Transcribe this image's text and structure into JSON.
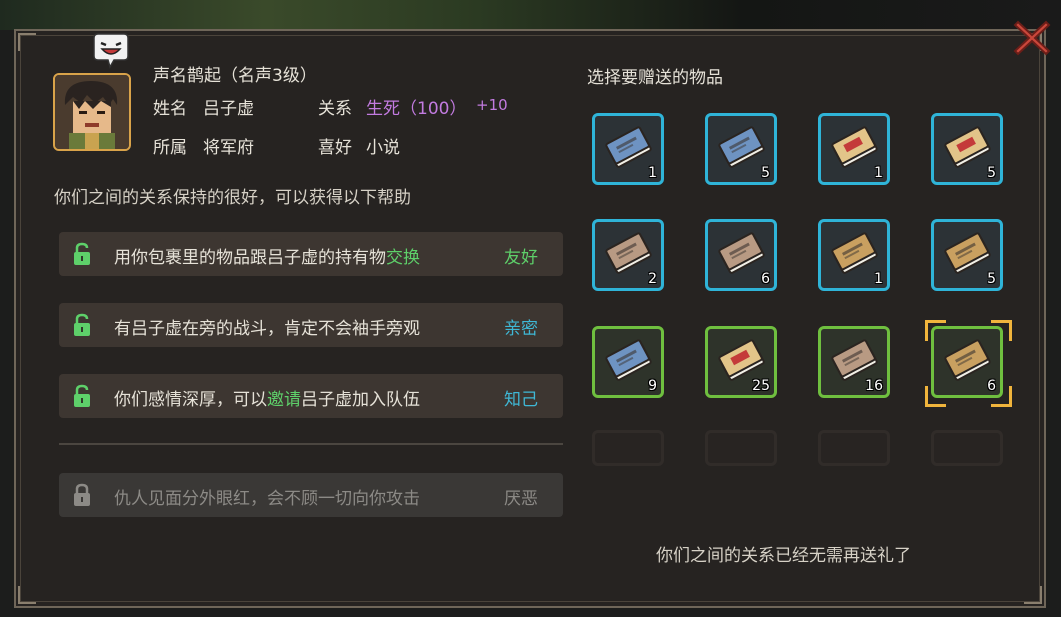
{
  "character": {
    "fame": "声名鹊起（名声3级）",
    "name_label": "姓名",
    "name": "吕子虚",
    "relation_label": "关系",
    "relation": "生死（100）",
    "relation_bonus": "+10",
    "faction_label": "所属",
    "faction": "将军府",
    "hobby_label": "喜好",
    "hobby": "小说"
  },
  "description": "你们之间的关系保持的很好，可以获得以下帮助",
  "benefits": [
    {
      "pre": "用你包裹里的物品跟吕子虚的持有物",
      "highlight": "交换",
      "post": "",
      "level": "友好",
      "level_color": "#5ed06a",
      "unlocked": true
    },
    {
      "pre": "有吕子虚在旁的战斗，肯定不会袖手旁观",
      "highlight": "",
      "post": "",
      "level": "亲密",
      "level_color": "#3fb8d6",
      "unlocked": true
    },
    {
      "pre": "你们感情深厚，可以",
      "highlight": "邀请",
      "post": "吕子虚加入队伍",
      "level": "知己",
      "level_color": "#3fb8d6",
      "unlocked": true
    },
    {
      "pre": "仇人见面分外眼红，会不顾一切向你攻击",
      "highlight": "",
      "post": "",
      "level": "厌恶",
      "level_color": "#8c8a86",
      "unlocked": false
    }
  ],
  "gift_title": "选择要赠送的物品",
  "items": [
    {
      "icon": "book-blue-icon",
      "qty": "1",
      "rarity": "blue",
      "cover": "#6e93c2"
    },
    {
      "icon": "book-blue-icon",
      "qty": "5",
      "rarity": "blue",
      "cover": "#6e93c2"
    },
    {
      "icon": "book-tan-red-icon",
      "qty": "1",
      "rarity": "blue",
      "cover": "#e2c489"
    },
    {
      "icon": "book-tan-red-icon",
      "qty": "5",
      "rarity": "blue",
      "cover": "#e2c489"
    },
    {
      "icon": "book-brown-icon",
      "qty": "2",
      "rarity": "blue",
      "cover": "#b89a83"
    },
    {
      "icon": "book-brown-icon",
      "qty": "6",
      "rarity": "blue",
      "cover": "#b89a83"
    },
    {
      "icon": "book-gold-icon",
      "qty": "1",
      "rarity": "blue",
      "cover": "#c9a060"
    },
    {
      "icon": "book-gold-icon",
      "qty": "5",
      "rarity": "blue",
      "cover": "#c9a060"
    },
    {
      "icon": "book-blue-icon",
      "qty": "9",
      "rarity": "green",
      "cover": "#6e93c2"
    },
    {
      "icon": "book-tan-red-icon",
      "qty": "25",
      "rarity": "green",
      "cover": "#e2c489"
    },
    {
      "icon": "book-brown-icon",
      "qty": "16",
      "rarity": "green",
      "cover": "#b89a83"
    },
    {
      "icon": "book-gold-icon",
      "qty": "6",
      "rarity": "green",
      "cover": "#c9a060",
      "selected": true
    }
  ],
  "footer_note": "你们之间的关系已经无需再送礼了",
  "colors": {
    "accent_green": "#5ed06a",
    "accent_cyan": "#3fb8d6",
    "relation_purple": "#c27be0",
    "slot_blue": "#2fb4d8",
    "slot_green": "#6fbf3f",
    "selection_gold": "#f0b43c",
    "close_red": "#c9473b"
  }
}
